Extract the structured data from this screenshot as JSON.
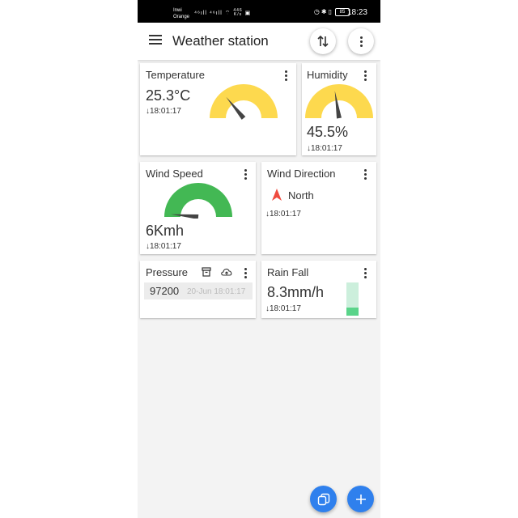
{
  "status_bar": {
    "carrier_line1": "Inwi",
    "carrier_line2": "Orange",
    "signal_icons": "⁴⁶ıll ⁴⁶ıll",
    "speed": "446",
    "speed_unit": "K/s",
    "battery": "85",
    "time": "18:23"
  },
  "appbar": {
    "title": "Weather station",
    "menu_icon": "hamburger-menu-icon",
    "sort_icon": "sort-arrows-icon",
    "more_icon": "more-vert-icon"
  },
  "cards": {
    "temperature": {
      "title": "Temperature",
      "value": "25.3°C",
      "updated": "18:01:17",
      "gauge_level": 0.28,
      "gauge_color": "#fdd94e"
    },
    "humidity": {
      "title": "Humidity",
      "value": "45.5%",
      "updated": "18:01:17",
      "gauge_level": 0.45,
      "gauge_color": "#fdd94e"
    },
    "wind_speed": {
      "title": "Wind Speed",
      "value": "6Kmh",
      "updated": "18:01:17",
      "gauge_level": 0.03,
      "gauge_color": "#43b854"
    },
    "wind_direction": {
      "title": "Wind Direction",
      "value": "North",
      "updated": "18:01:17",
      "arrow_color": "#ef4b3f"
    },
    "pressure": {
      "title": "Pressure",
      "value": "97200",
      "date": "20-Jun 18:01:17",
      "archive_icon": "archive-icon",
      "cloud_icon": "cloud-upload-icon"
    },
    "rain_fall": {
      "title": "Rain Fall",
      "value": "8.3mm/h",
      "updated": "18:01:17",
      "level": 0.25,
      "bar_color": "#5ad48a"
    }
  },
  "fabs": {
    "copy_icon": "copy-icon",
    "add_icon": "add-icon",
    "color": "#2f80ed"
  }
}
